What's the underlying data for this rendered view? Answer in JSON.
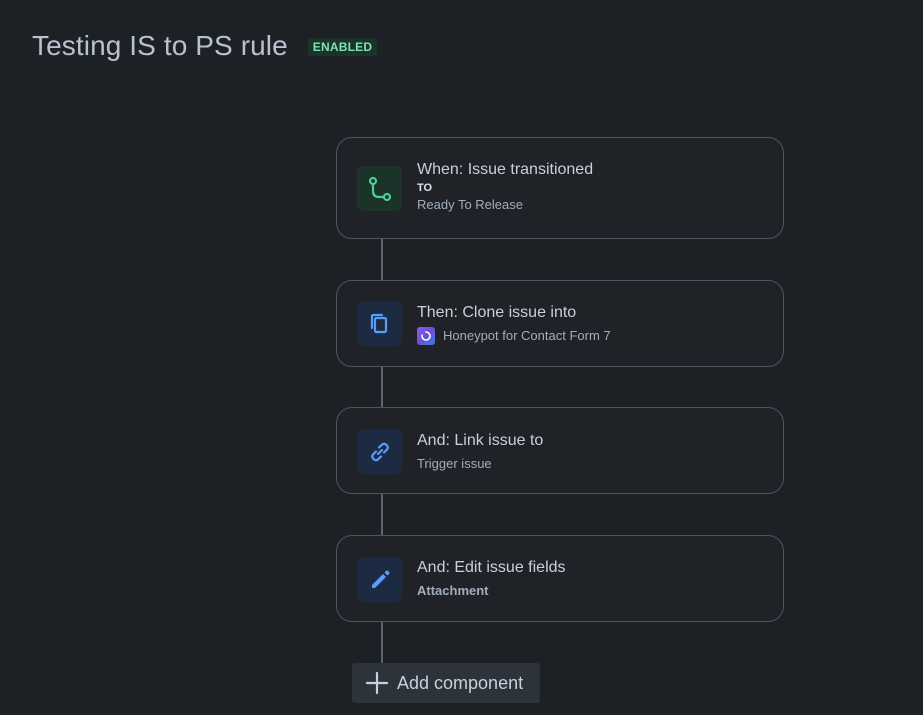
{
  "rule": {
    "title": "Testing IS to PS rule",
    "status": "ENABLED"
  },
  "components": [
    {
      "heading": "When: Issue transitioned",
      "label": "TO",
      "detail": "Ready To Release",
      "icon": "branch-transition-icon"
    },
    {
      "heading": "Then: Clone issue into",
      "project": "Honeypot for Contact Form 7",
      "icon": "copy-icon"
    },
    {
      "heading": "And: Link issue to",
      "detail": "Trigger issue",
      "icon": "link-icon"
    },
    {
      "heading": "And: Edit issue fields",
      "detail": "Attachment",
      "icon": "pencil-icon"
    }
  ],
  "add_component": {
    "label": "Add component"
  },
  "colors": {
    "background": "#1d2125",
    "card_border": "#4d5661",
    "enabled_badge": "#7ee2b8",
    "trigger_icon": "#4bce97",
    "action_icon": "#579dff"
  }
}
